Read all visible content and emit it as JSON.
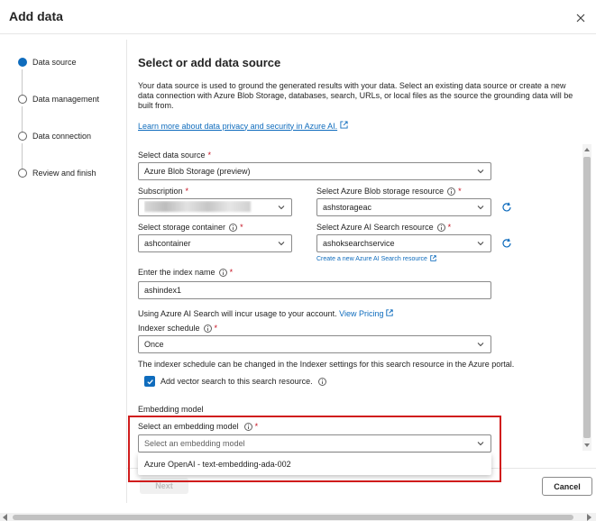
{
  "dialog": {
    "title": "Add data"
  },
  "steps": [
    {
      "label": "Data source",
      "active": true
    },
    {
      "label": "Data management",
      "active": false
    },
    {
      "label": "Data connection",
      "active": false
    },
    {
      "label": "Review and finish",
      "active": false
    }
  ],
  "main": {
    "title": "Select or add data source",
    "description": "Your data source is used to ground the generated results with your data. Select an existing data source or create a new data connection with Azure Blob Storage, databases, search, URLs, or local files as the source the grounding data will be built from.",
    "learn_more": "Learn more about data privacy and security in Azure AI."
  },
  "form": {
    "data_source": {
      "label": "Select data source",
      "value": "Azure Blob Storage (preview)"
    },
    "subscription": {
      "label": "Subscription",
      "value": ""
    },
    "blob_storage": {
      "label": "Select Azure Blob storage resource",
      "value": "ashstorageac"
    },
    "storage_container": {
      "label": "Select storage container",
      "value": "ashcontainer"
    },
    "search_resource": {
      "label": "Select Azure AI Search resource",
      "value": "ashoksearchservice",
      "create_link": "Create a new Azure AI Search resource"
    },
    "index_name": {
      "label": "Enter the index name",
      "value": "ashindex1"
    },
    "usage_note": "Using Azure AI Search will incur usage to your account.",
    "pricing_link": "View Pricing",
    "indexer_schedule": {
      "label": "Indexer schedule",
      "value": "Once"
    },
    "schedule_note": "The indexer schedule can be changed in the Indexer settings for this search resource in the Azure portal.",
    "vector_search": {
      "label": "Add vector search to this search resource.",
      "checked": true
    },
    "embedding": {
      "section_label": "Embedding model",
      "label": "Select an embedding model",
      "placeholder": "Select an embedding model",
      "options": [
        "Azure OpenAI - text-embedding-ada-002"
      ]
    },
    "required_mark": "*"
  },
  "footer": {
    "next": "Next",
    "cancel": "Cancel"
  },
  "colors": {
    "accent": "#0f6cbd",
    "highlight": "#d01c1c",
    "required": "#c50f1f"
  }
}
